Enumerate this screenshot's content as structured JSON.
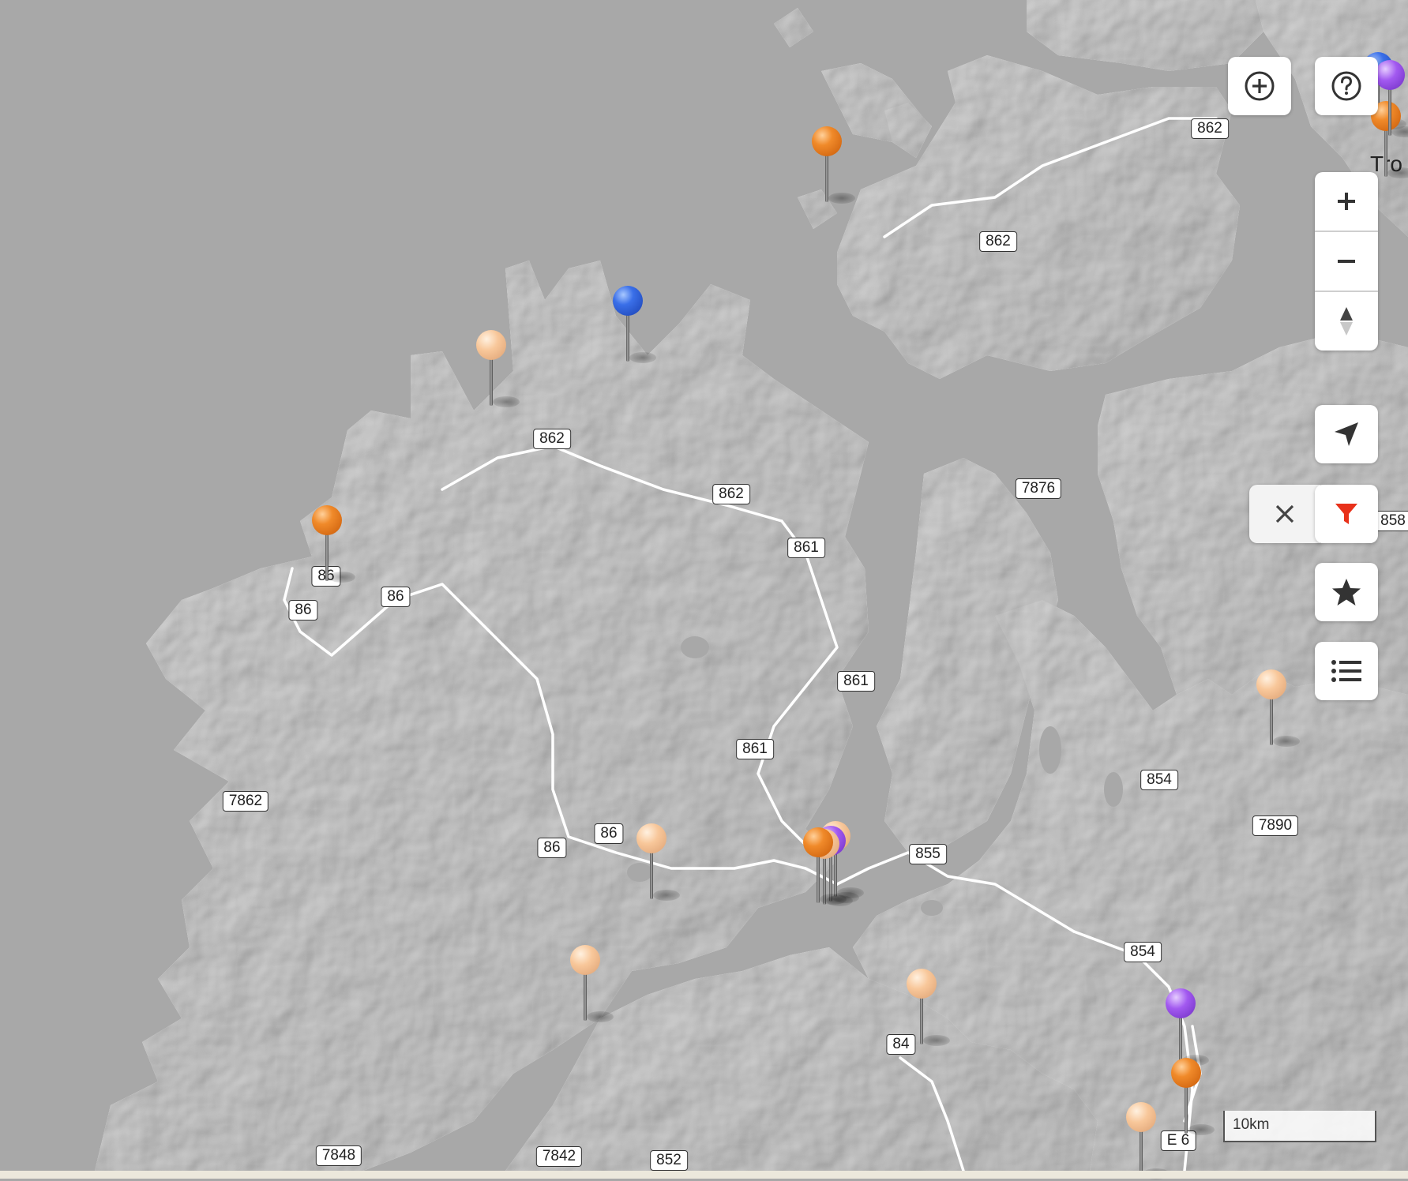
{
  "map": {
    "place_label": "Tro",
    "road_labels": [
      "862",
      "862",
      "862",
      "862",
      "7876",
      "861",
      "861",
      "861",
      "86",
      "86",
      "86",
      "86",
      "86",
      "855",
      "854",
      "854",
      "7890",
      "7862",
      "84",
      "E 6",
      "7848",
      "7842",
      "852",
      "858"
    ],
    "pins": [
      {
        "color": "orange"
      },
      {
        "color": "peach"
      },
      {
        "color": "blue"
      },
      {
        "color": "orange"
      },
      {
        "color": "peach"
      },
      {
        "color": "purple"
      },
      {
        "color": "peach"
      },
      {
        "color": "orange"
      },
      {
        "color": "peach"
      },
      {
        "color": "peach"
      },
      {
        "color": "peach"
      },
      {
        "color": "purple"
      },
      {
        "color": "orange"
      },
      {
        "color": "peach"
      }
    ]
  },
  "controls": {
    "add_icon": "plus-circle-icon",
    "help_icon": "question-circle-icon",
    "zoom_in_icon": "plus-icon",
    "zoom_out_icon": "minus-icon",
    "compass_icon": "compass-icon",
    "locate_icon": "navigation-arrow-icon",
    "clear_filter_icon": "close-icon",
    "filter_icon": "filter-icon",
    "filter_color": "#e8311a",
    "favorites_icon": "star-icon",
    "list_icon": "list-icon"
  },
  "scale_bar": {
    "label": "10km"
  },
  "colors": {
    "water": "#a8a8a8",
    "land": "#d9d9d9",
    "road": "#ffffff"
  }
}
